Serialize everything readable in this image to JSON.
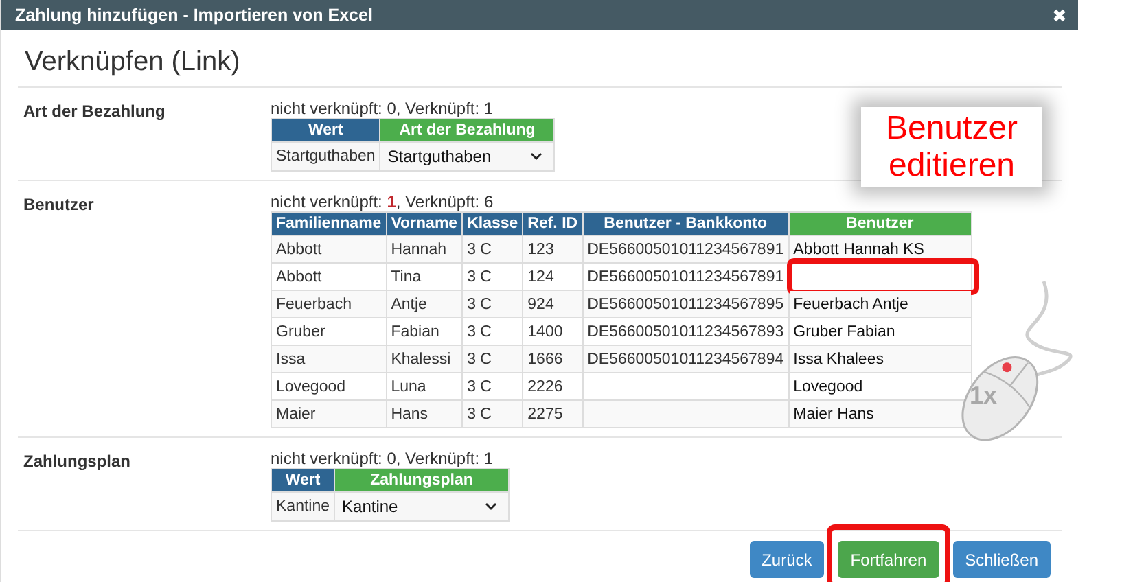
{
  "window": {
    "title": "Zahlung hinzufügen - Importieren von Excel",
    "close": "✖"
  },
  "heading": "Verknüpfen (Link)",
  "sections": [
    {
      "kind": "select",
      "label": "Art der Bezahlung",
      "status": "nicht verknüpft: 0, Verknüpft: 1",
      "columns": [
        "Wert",
        "Art der Bezahlung"
      ],
      "rows": [
        {
          "value": "Startguthaben",
          "choice": "Startguthaben"
        }
      ]
    },
    {
      "kind": "users",
      "label": "Benutzer",
      "status": "nicht verknüpft: **1**, Verknüpft: 6",
      "columns": [
        "Familienname",
        "Vorname",
        "Klasse",
        "Ref. ID",
        "Benutzer - Bankkonto",
        "Benutzer"
      ],
      "rows": [
        {
          "cells": [
            "Abbott",
            "Hannah",
            "3 C",
            "123",
            "DE56600501011234567891"
          ],
          "user": "Abbott Hannah KS",
          "highlighted": false
        },
        {
          "cells": [
            "Abbott",
            "Tina",
            "3 C",
            "124",
            "DE56600501011234567891"
          ],
          "highlighted": true
        },
        {
          "cells": [
            "Feuerbach",
            "Antje",
            "3 C",
            "924",
            "DE56600501011234567895"
          ],
          "user": "Feuerbach Antje",
          "highlighted": false
        },
        {
          "cells": [
            "Gruber",
            "Fabian",
            "3 C",
            "1400",
            "DE56600501011234567893"
          ],
          "user": "Gruber Fabian",
          "highlighted": false
        },
        {
          "cells": [
            "Issa",
            "Khalessi",
            "3 C",
            "1666",
            "DE56600501011234567894"
          ],
          "user": "Issa Khalees",
          "highlighted": false
        },
        {
          "cells": [
            "Lovegood",
            "Luna",
            "3 C",
            "2226"
          ],
          "user": "Lovegood",
          "highlighted": false
        },
        {
          "cells": [
            "Maier",
            "Hans",
            "3 C",
            "2275"
          ],
          "user": "Maier Hans",
          "highlighted": false
        }
      ]
    },
    {
      "kind": "select",
      "label": "Zahlungsplan",
      "status": "nicht verknüpft: 0, Verknüpft: 1",
      "columns": [
        "Wert",
        "Zahlungsplan"
      ],
      "rows": [
        {
          "value": "Kantine",
          "choice": "Kantine"
        }
      ]
    }
  ],
  "buttons": [
    {
      "label": "Zurück",
      "kind": "primary",
      "highlighted": false
    },
    {
      "label": "Fortfahren",
      "kind": "success",
      "highlighted": true
    },
    {
      "label": "Schließen",
      "kind": "primary",
      "highlighted": false
    }
  ],
  "callout": "Benutzer editieren",
  "click_count": "1x"
}
